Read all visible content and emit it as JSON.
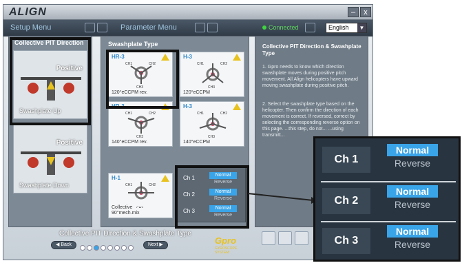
{
  "app": {
    "logo": "ALIGN",
    "minimize_label": "–",
    "close_label": "x"
  },
  "menubar": {
    "setup_menu": "Setup Menu",
    "parameter_menu": "Parameter Menu",
    "status": "Connected",
    "language": "English"
  },
  "left_panel": {
    "title": "Collective PIT Direction",
    "cards": [
      {
        "label": "Positive",
        "caption": "Swashplate Up"
      },
      {
        "label": "Positive",
        "caption": "Swashplate Down"
      }
    ]
  },
  "center_panel": {
    "title": "Swashplate Type",
    "types": [
      {
        "name": "HR-3",
        "footer": "120°eCCPM rev."
      },
      {
        "name": "H-3",
        "footer": "120°eCCPM"
      },
      {
        "name": "HR-3",
        "footer": "140°eCCPM rev."
      },
      {
        "name": "H-3",
        "footer": "140°eCCPM"
      },
      {
        "name": "H-1",
        "footer": "Collective 90°mech.mix"
      }
    ],
    "channels": [
      {
        "label": "Ch 1",
        "normal": "Normal",
        "reverse": "Reverse"
      },
      {
        "label": "Ch 2",
        "normal": "Normal",
        "reverse": "Reverse"
      },
      {
        "label": "Ch 3",
        "normal": "Normal",
        "reverse": "Reverse"
      }
    ],
    "servo_labels": [
      "CH1",
      "CH2",
      "CH3"
    ]
  },
  "right_panel": {
    "title": "Collective PIT Direction & Swashplate Type",
    "step1": "1. Gpro needs to know which direction swashplate moves during positive pitch movement. All Align helicopters have upward moving swashplate during positive pitch.",
    "step2": "2. Select the swashplate type based on the helicopter. Then confirm the direction of each movement is correct. If reversed, correct by selecting the corresponding reverse option on this page. ...this step, do not... ...using transmitt..."
  },
  "bottom": {
    "title": "Collective PIT Direction & Swashplate Type",
    "back_label": "Back",
    "next_label": "Next",
    "brand": "Gpro",
    "brand_sub": "GYROSCOPE SYSTEM",
    "page_dots": 8,
    "active_dot": 3
  },
  "zoom": {
    "channels": [
      {
        "label": "Ch 1",
        "normal": "Normal",
        "reverse": "Reverse"
      },
      {
        "label": "Ch 2",
        "normal": "Normal",
        "reverse": "Reverse"
      },
      {
        "label": "Ch 3",
        "normal": "Normal",
        "reverse": "Reverse"
      }
    ]
  },
  "colors": {
    "accent": "#3aa4e8",
    "warning": "#e8c21e",
    "connected": "#3fd33f"
  }
}
